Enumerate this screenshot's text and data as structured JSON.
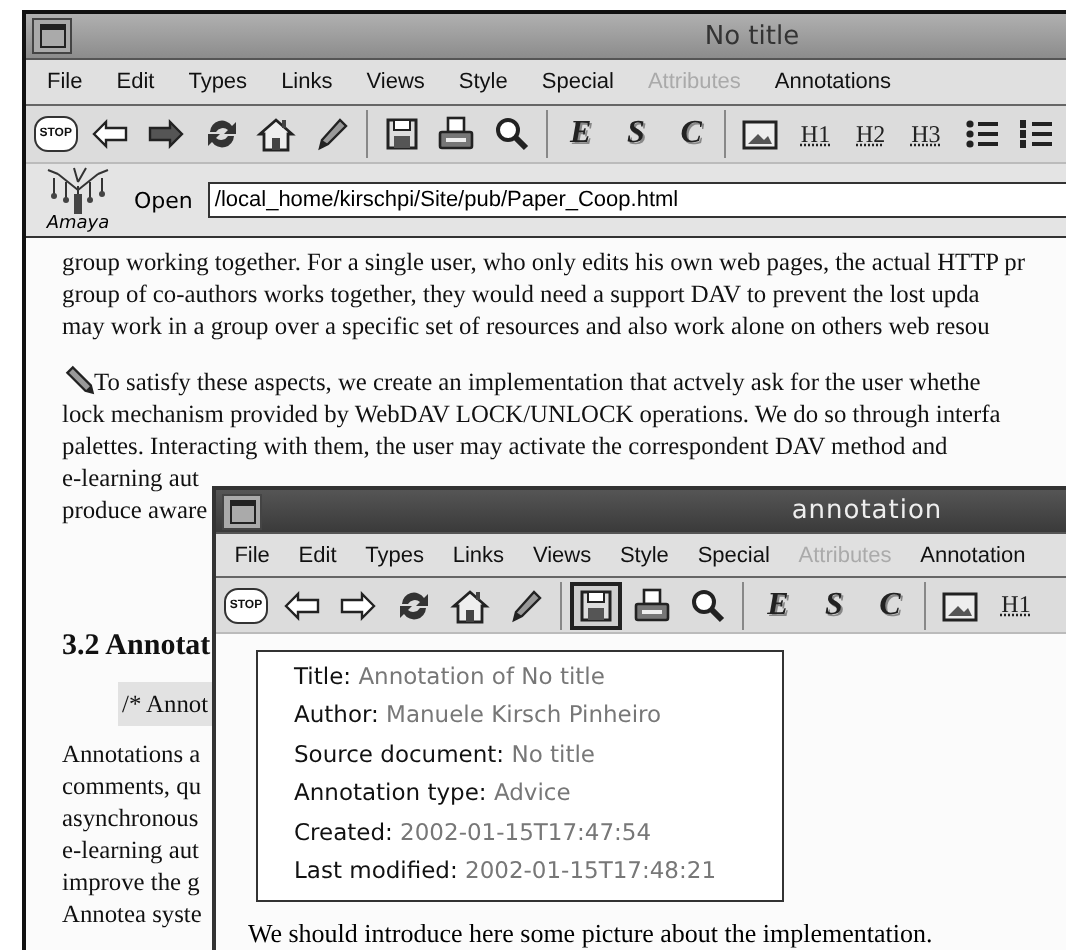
{
  "main_window": {
    "title": "No title",
    "menu": [
      {
        "label": "File",
        "disabled": false
      },
      {
        "label": "Edit",
        "disabled": false
      },
      {
        "label": "Types",
        "disabled": false
      },
      {
        "label": "Links",
        "disabled": false
      },
      {
        "label": "Views",
        "disabled": false
      },
      {
        "label": "Style",
        "disabled": false
      },
      {
        "label": "Special",
        "disabled": false
      },
      {
        "label": "Attributes",
        "disabled": true
      },
      {
        "label": "Annotations",
        "disabled": false
      }
    ],
    "toolbar": [
      {
        "kind": "stop",
        "label": "STOP",
        "pressed": false,
        "disabled": false
      },
      {
        "kind": "back",
        "pressed": false,
        "disabled": true
      },
      {
        "kind": "forward",
        "pressed": false,
        "disabled": false
      },
      {
        "kind": "reload",
        "pressed": false,
        "disabled": false
      },
      {
        "kind": "home",
        "pressed": false,
        "disabled": false
      },
      {
        "kind": "pencil",
        "pressed": false,
        "disabled": false
      },
      {
        "kind": "separator"
      },
      {
        "kind": "save",
        "pressed": false,
        "disabled": false
      },
      {
        "kind": "print",
        "pressed": false,
        "disabled": false
      },
      {
        "kind": "find",
        "pressed": false,
        "disabled": false
      },
      {
        "kind": "separator"
      },
      {
        "kind": "letter",
        "label": "E",
        "pressed": false,
        "disabled": false
      },
      {
        "kind": "letter",
        "label": "S",
        "pressed": false,
        "disabled": false
      },
      {
        "kind": "letter",
        "label": "C",
        "pressed": false,
        "disabled": false
      },
      {
        "kind": "separator"
      },
      {
        "kind": "image",
        "pressed": false,
        "disabled": false
      },
      {
        "kind": "heading",
        "label": "H1",
        "pressed": false,
        "disabled": false
      },
      {
        "kind": "heading",
        "label": "H2",
        "pressed": false,
        "disabled": false
      },
      {
        "kind": "heading",
        "label": "H3",
        "pressed": false,
        "disabled": false
      },
      {
        "kind": "bullets",
        "pressed": false,
        "disabled": false
      },
      {
        "kind": "numbers",
        "pressed": false,
        "disabled": false
      }
    ],
    "logo_text": "Amaya",
    "open_label": "Open",
    "address": "/local_home/kirschpi/Site/pub/Paper_Coop.html",
    "content": [
      {
        "kind": "paragraph",
        "lines": [
          "group working together. For a single user, who only edits his own web pages, the actual HTTP pr",
          "group of co-authors works together, they would need a support DAV to prevent the lost upda",
          "may work in a group over a specific set of resources and also work alone on others web resou"
        ]
      },
      {
        "kind": "annotated",
        "lines": [
          "To satisfy these aspects, we create an implementation that actvely ask for the user whethe",
          "lock mechanism provided by WebDAV LOCK/UNLOCK operations. We do so through interfa",
          "palettes. Interacting with them, the user may activate the correspondent DAV method and",
          "e-learning aut",
          "produce aware"
        ]
      },
      {
        "kind": "heading",
        "lines": [
          "3.2 Annotat"
        ]
      },
      {
        "kind": "comment",
        "lines": [
          "/* Annot"
        ]
      },
      {
        "kind": "paragraph",
        "lines": [
          "Annotations a",
          "comments, qu",
          "asynchronous",
          "e-learning aut",
          "improve the g",
          "Annotea syste"
        ]
      }
    ]
  },
  "annotation_window": {
    "title": "annotation",
    "menu": [
      {
        "label": "File",
        "disabled": false
      },
      {
        "label": "Edit",
        "disabled": false
      },
      {
        "label": "Types",
        "disabled": false
      },
      {
        "label": "Links",
        "disabled": false
      },
      {
        "label": "Views",
        "disabled": false
      },
      {
        "label": "Style",
        "disabled": false
      },
      {
        "label": "Special",
        "disabled": false
      },
      {
        "label": "Attributes",
        "disabled": true
      },
      {
        "label": "Annotation",
        "disabled": false
      }
    ],
    "toolbar": [
      {
        "kind": "stop",
        "label": "STOP",
        "pressed": false,
        "disabled": false
      },
      {
        "kind": "back",
        "pressed": false,
        "disabled": true
      },
      {
        "kind": "forward",
        "pressed": false,
        "disabled": true
      },
      {
        "kind": "reload",
        "pressed": false,
        "disabled": false
      },
      {
        "kind": "home",
        "pressed": false,
        "disabled": false
      },
      {
        "kind": "pencil",
        "pressed": false,
        "disabled": false
      },
      {
        "kind": "separator"
      },
      {
        "kind": "save",
        "pressed": true,
        "disabled": false
      },
      {
        "kind": "print",
        "pressed": false,
        "disabled": false
      },
      {
        "kind": "find",
        "pressed": false,
        "disabled": false
      },
      {
        "kind": "separator"
      },
      {
        "kind": "letter",
        "label": "E",
        "pressed": false,
        "disabled": false
      },
      {
        "kind": "letter",
        "label": "S",
        "pressed": false,
        "disabled": false
      },
      {
        "kind": "letter",
        "label": "C",
        "pressed": false,
        "disabled": false
      },
      {
        "kind": "separator"
      },
      {
        "kind": "image",
        "pressed": false,
        "disabled": false
      },
      {
        "kind": "heading",
        "label": "H1",
        "pressed": false,
        "disabled": false
      }
    ],
    "metadata": [
      {
        "label": "Title:",
        "value": "Annotation of No title"
      },
      {
        "label": "Author:",
        "value": "Manuele Kirsch Pinheiro"
      },
      {
        "label": "Source document:",
        "value": "No title"
      },
      {
        "label": "Annotation type:",
        "value": "Advice"
      },
      {
        "label": "Created:",
        "value": "2002-01-15T17:47:54"
      },
      {
        "label": "Last modified:",
        "value": "2002-01-15T17:48:21"
      }
    ],
    "body": "We should introduce here some picture about the implementation."
  }
}
